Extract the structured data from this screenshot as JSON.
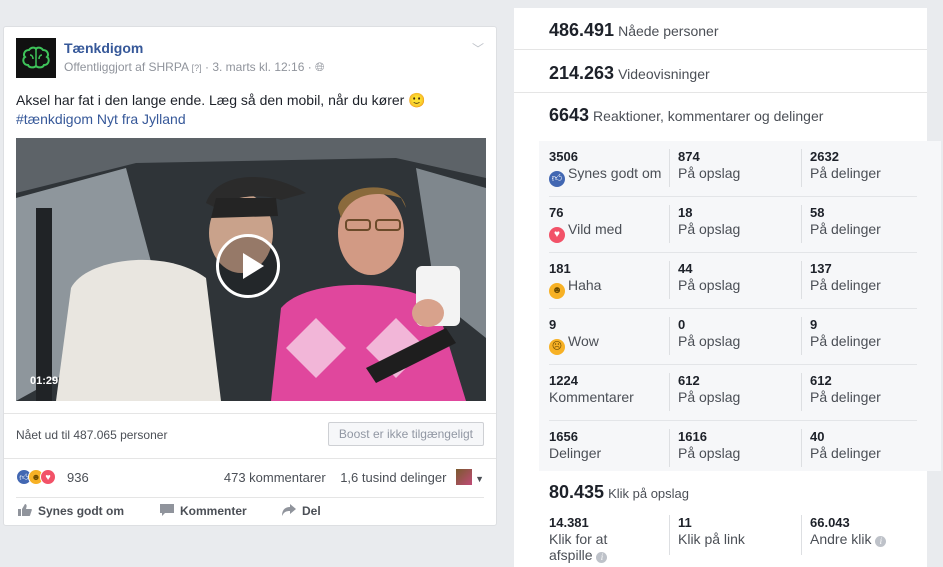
{
  "post": {
    "page_name": "Tænkdigom",
    "published_by": "Offentliggjort af SHRPA",
    "help_marker": "[?]",
    "date": "3. marts kl. 12:16",
    "text": "Aksel har fat i den lange ende. Læg så den mobil, når du kører 🙂",
    "hashtags": "#tænkdigom Nyt fra Jylland",
    "video_duration": "01:29",
    "reach_text": "Nået ud til 487.065 personer",
    "boost_label": "Boost er ikke tilgængeligt",
    "reaction_count": "936",
    "comments_count": "473 kommentarer",
    "shares_count": "1,6 tusind delinger",
    "actions": {
      "like": "Synes godt om",
      "comment": "Kommenter",
      "share": "Del"
    }
  },
  "insights": {
    "reached": {
      "value": "486.491",
      "label": "Nåede personer"
    },
    "video_views": {
      "value": "214.263",
      "label": "Videovisninger"
    },
    "engagement": {
      "value": "6643",
      "label": "Reaktioner, kommentarer og delinger"
    },
    "rows": [
      {
        "total": "3506",
        "label": "Synes godt om",
        "icon": "like",
        "on_post": "874",
        "on_post_label": "På opslag",
        "on_shares": "2632",
        "on_shares_label": "På delinger"
      },
      {
        "total": "76",
        "label": "Vild med",
        "icon": "love",
        "on_post": "18",
        "on_post_label": "På opslag",
        "on_shares": "58",
        "on_shares_label": "På delinger"
      },
      {
        "total": "181",
        "label": "Haha",
        "icon": "haha",
        "on_post": "44",
        "on_post_label": "På opslag",
        "on_shares": "137",
        "on_shares_label": "På delinger"
      },
      {
        "total": "9",
        "label": "Wow",
        "icon": "wow",
        "on_post": "0",
        "on_post_label": "På opslag",
        "on_shares": "9",
        "on_shares_label": "På delinger"
      },
      {
        "total": "1224",
        "label": "Kommentarer",
        "icon": "",
        "on_post": "612",
        "on_post_label": "På opslag",
        "on_shares": "612",
        "on_shares_label": "På delinger"
      },
      {
        "total": "1656",
        "label": "Delinger",
        "icon": "",
        "on_post": "1616",
        "on_post_label": "På opslag",
        "on_shares": "40",
        "on_shares_label": "På delinger"
      }
    ],
    "post_clicks": {
      "value": "80.435",
      "label": "Klik på opslag"
    },
    "click_breakdown": [
      {
        "value": "14.381",
        "label": "Klik for at afspille",
        "info": true
      },
      {
        "value": "11",
        "label": "Klik på link",
        "info": false
      },
      {
        "value": "66.043",
        "label": "Andre klik",
        "info": true
      }
    ],
    "colors": {
      "link": "#365899",
      "like": "#4267b2",
      "love": "#f25268",
      "haha": "#f7b125"
    }
  }
}
